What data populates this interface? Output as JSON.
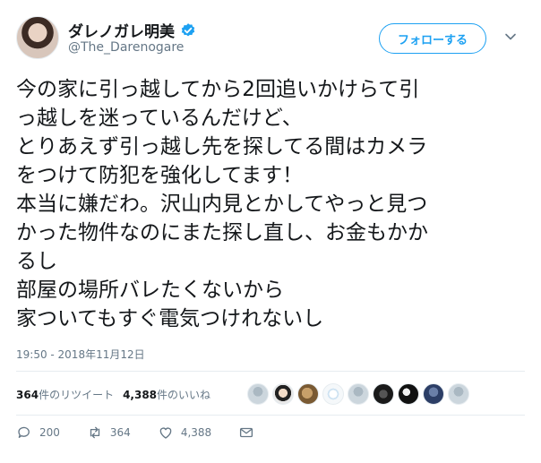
{
  "user": {
    "display_name": "ダレノガレ明美",
    "handle": "@The_Darenogare",
    "verified_icon": "verified-badge-icon",
    "follow_label": "フォローする"
  },
  "tweet": {
    "text": "今の家に引っ越してから2回追いかけらて引\nっ越しを迷っているんだけど、\nとりあえず引っ越し先を探してる間はカメラ\nをつけて防犯を強化してます！\n本当に嫌だわ。沢山内見とかしてやっと見つ\nかった物件なのにまた探し直し、お金もかか\nるし\n部屋の場所バレたくないから\n家ついてもすぐ電気つけれないし",
    "timestamp": "19:50 - 2018年11月12日"
  },
  "stats": {
    "retweets_count": "364",
    "retweets_label": "件のリツイート",
    "likes_count": "4,388",
    "likes_label": "件のいいね"
  },
  "actions": {
    "reply_count": "200",
    "retweet_count": "364",
    "like_count": "4,388"
  },
  "colors": {
    "accent": "#1da1f2",
    "text": "#14171a",
    "muted": "#657786",
    "divider": "#e6ecf0"
  }
}
